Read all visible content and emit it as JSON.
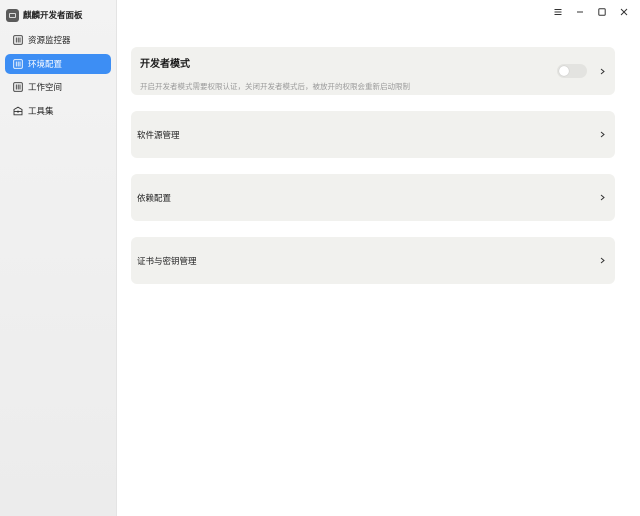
{
  "app": {
    "title": "麒麟开发者面板"
  },
  "sidebar": {
    "items": [
      {
        "label": "资源监控器",
        "icon": "monitor-icon",
        "active": false
      },
      {
        "label": "环境配置",
        "icon": "settings-panel-icon",
        "active": true
      },
      {
        "label": "工作空间",
        "icon": "workspace-icon",
        "active": false
      },
      {
        "label": "工具集",
        "icon": "toolbox-icon",
        "active": false
      }
    ]
  },
  "titlebar": {
    "menu_icon": "menu-icon",
    "minimize_icon": "minimize-icon",
    "maximize_icon": "maximize-icon",
    "close_icon": "close-icon"
  },
  "main": {
    "developer_mode": {
      "title": "开发者模式",
      "description": "开启开发者模式需要权限认证，关闭开发者模式后，被放开的权限会重新启动限制",
      "enabled": false
    },
    "rows": [
      {
        "label": "软件源管理"
      },
      {
        "label": "依赖配置"
      },
      {
        "label": "证书与密钥管理"
      }
    ]
  },
  "colors": {
    "accent": "#3d8ef4",
    "card_bg": "#f1f1ee",
    "sidebar_bg": "#f0f0f0"
  }
}
